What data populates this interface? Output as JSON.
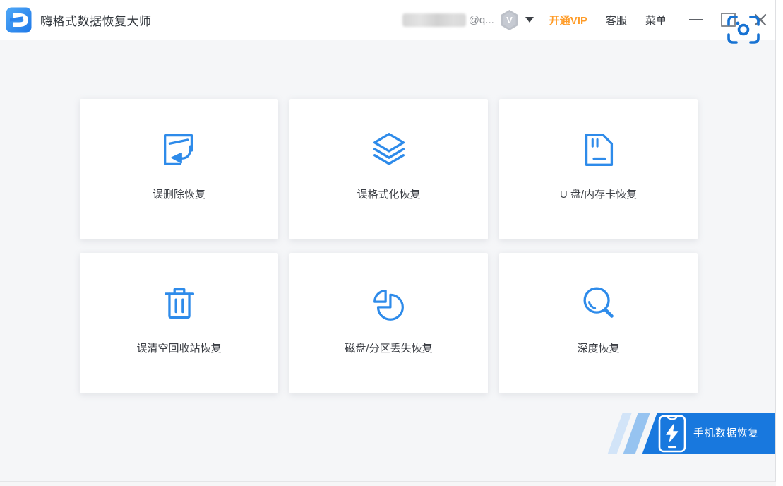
{
  "window": {
    "title": "嗨格式数据恢复大师"
  },
  "titlebar": {
    "account": {
      "email_suffix": "@q...",
      "vip_badge_letter": "V"
    },
    "open_vip_label": "开通VIP",
    "customer_service_label": "客服",
    "menu_label": "菜单"
  },
  "cards": [
    {
      "label": "误删除恢复",
      "icon": "restore-file-icon"
    },
    {
      "label": "误格式化恢复",
      "icon": "layers-icon"
    },
    {
      "label": "U 盘/内存卡恢复",
      "icon": "sd-card-icon"
    },
    {
      "label": "误清空回收站恢复",
      "icon": "trash-icon"
    },
    {
      "label": "磁盘/分区丢失恢复",
      "icon": "pie-chart-icon"
    },
    {
      "label": "深度恢复",
      "icon": "magnifier-icon"
    }
  ],
  "footer_banner": {
    "label": "手机数据恢复",
    "icon": "phone-lightning-icon"
  },
  "colors": {
    "card_icon_blue": "#2e8bea",
    "banner_blue": "#1878de",
    "vip_orange": "#ff9c28",
    "logo_blue": "#2f8ef0",
    "text_dark": "#3b3e44",
    "background": "#f5f6f8"
  }
}
